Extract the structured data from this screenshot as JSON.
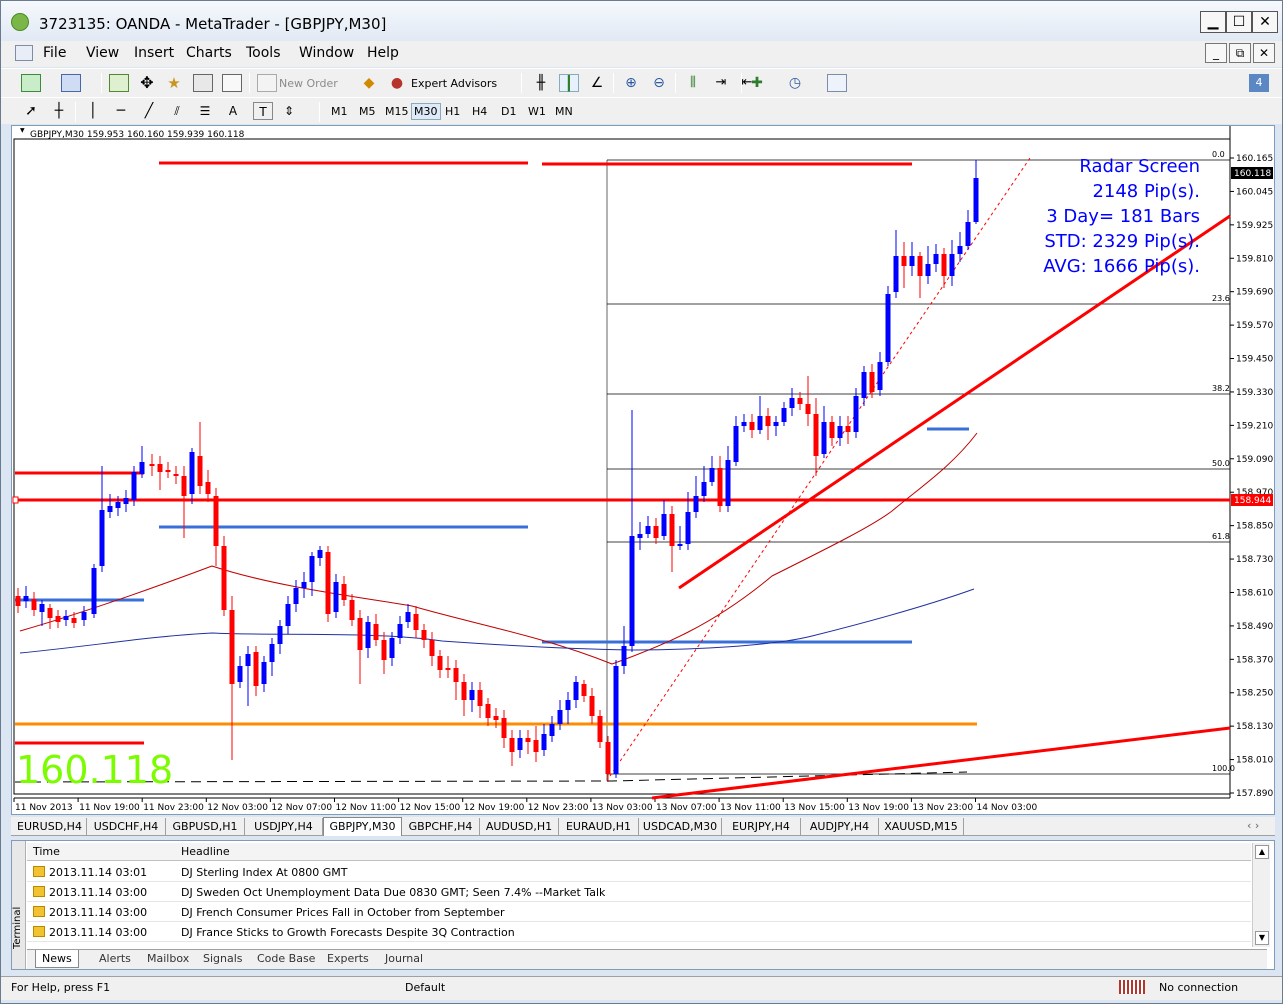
{
  "window": {
    "title": "3723135: OANDA - MetaTrader - [GBPJPY,M30]",
    "minimize": "▁",
    "maximize": "☐",
    "close": "✕"
  },
  "menu": [
    "File",
    "View",
    "Insert",
    "Charts",
    "Tools",
    "Window",
    "Help"
  ],
  "toolbar": {
    "new_order": "New Order",
    "expert_advisors": "Expert Advisors"
  },
  "timeframes": [
    "M1",
    "M5",
    "M15",
    "M30",
    "H1",
    "H4",
    "D1",
    "W1",
    "MN"
  ],
  "drawing_text_tool": "A",
  "chart": {
    "header": "GBPJPY,M30  159.953 160.160 159.939 160.118",
    "big_price": "160.118",
    "radar": [
      "Radar Screen",
      "2148 Pip(s).",
      "3 Day= 181 Bars",
      "STD: 2329 Pip(s).",
      "AVG: 1666 Pip(s)."
    ],
    "current_price_tag": "160.118",
    "line_price_tag": "158.944",
    "price_labels": [
      "160.165",
      "160.045",
      "159.925",
      "159.810",
      "159.690",
      "159.570",
      "159.450",
      "159.330",
      "159.210",
      "159.090",
      "158.970",
      "158.850",
      "158.730",
      "158.610",
      "158.490",
      "158.370",
      "158.250",
      "158.130",
      "158.010",
      "157.890"
    ],
    "fib_labels": [
      "0.0",
      "23.6",
      "38.2",
      "50.0",
      "61.8",
      "100.0"
    ],
    "time_labels": [
      "11 Nov 2013",
      "11 Nov 19:00",
      "11 Nov 23:00",
      "12 Nov 03:00",
      "12 Nov 07:00",
      "12 Nov 11:00",
      "12 Nov 15:00",
      "12 Nov 19:00",
      "12 Nov 23:00",
      "13 Nov 03:00",
      "13 Nov 07:00",
      "13 Nov 11:00",
      "13 Nov 15:00",
      "13 Nov 19:00",
      "13 Nov 23:00",
      "14 Nov 03:00"
    ],
    "colors": {
      "bull": "#0000ff",
      "bear": "#ff0000",
      "ma_red": "#c00000",
      "ma_blue": "#2030a0",
      "level": "#ff0000",
      "orange": "#ff8c00",
      "blue_level": "#3a6fd8"
    }
  },
  "symbol_tabs": [
    "EURUSD,H4",
    "USDCHF,H4",
    "GBPUSD,H1",
    "USDJPY,H4",
    "GBPJPY,M30",
    "GBPCHF,H4",
    "AUDUSD,H1",
    "EURAUD,H1",
    "USDCAD,M30",
    "EURJPY,H4",
    "AUDJPY,H4",
    "XAUUSD,M15"
  ],
  "active_symbol_tab": "GBPJPY,M30",
  "terminal": {
    "side_label": "Terminal",
    "col_time": "Time",
    "col_headline": "Headline",
    "rows": [
      {
        "time": "2013.11.14 03:01",
        "headline": "DJ  Sterling Index At 0800 GMT"
      },
      {
        "time": "2013.11.14 03:00",
        "headline": "DJ  Sweden Oct Unemployment Data Due 0830 GMT; Seen 7.4% --Market Talk"
      },
      {
        "time": "2013.11.14 03:00",
        "headline": "DJ  French Consumer Prices Fall in October from September"
      },
      {
        "time": "2013.11.14 03:00",
        "headline": "DJ  France Sticks to Growth Forecasts Despite 3Q Contraction"
      }
    ],
    "tabs": [
      "News",
      "Alerts",
      "Mailbox",
      "Signals",
      "Code Base",
      "Experts",
      "Journal"
    ]
  },
  "status": {
    "help": "For Help, press F1",
    "profile": "Default",
    "connection": "No connection"
  }
}
